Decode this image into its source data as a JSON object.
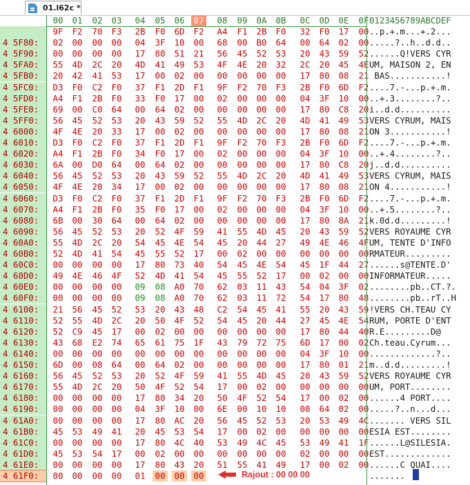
{
  "tab": {
    "title": "01.l62c *"
  },
  "header": {
    "columns": [
      "00",
      "01",
      "02",
      "03",
      "04",
      "05",
      "06",
      "07",
      "08",
      "09",
      "0A",
      "0B",
      "0C",
      "0D",
      "0E",
      "0F"
    ],
    "ascii_header": "0123456789ABCDEF",
    "highlighted_column": "07"
  },
  "annotation": {
    "text": "Rajout : 00 00 00"
  },
  "rows": [
    {
      "addr": "",
      "hex": [
        "9F",
        "F2",
        "70",
        "F3",
        "2B",
        "F0",
        "6D",
        "F2",
        "A4",
        "F1",
        "2B",
        "F0",
        "32",
        "F0",
        "17",
        "00"
      ],
      "ascii": "..p.+.m...+.2..."
    },
    {
      "addr": "4 5F80:",
      "hex": [
        "02",
        "00",
        "00",
        "00",
        "04",
        "3F",
        "10",
        "00",
        "68",
        "00",
        "B0",
        "64",
        "00",
        "64",
        "02",
        "00"
      ],
      "ascii": ".....?..h..d.d.."
    },
    {
      "addr": "4 5F90:",
      "hex": [
        "00",
        "00",
        "00",
        "00",
        "17",
        "80",
        "51",
        "21",
        "56",
        "45",
        "52",
        "53",
        "20",
        "43",
        "59",
        "52"
      ],
      "ascii": "......Q!VERS CYR"
    },
    {
      "addr": "4 5FA0:",
      "hex": [
        "55",
        "4D",
        "2C",
        "20",
        "4D",
        "41",
        "49",
        "53",
        "4F",
        "4E",
        "20",
        "32",
        "2C",
        "20",
        "45",
        "4E"
      ],
      "ascii": "UM, MAISON 2, EN"
    },
    {
      "addr": "4 5FB0:",
      "hex": [
        "20",
        "42",
        "41",
        "53",
        "17",
        "00",
        "02",
        "00",
        "00",
        "00",
        "00",
        "00",
        "17",
        "80",
        "08",
        "21"
      ],
      "ascii": " BAS...........!"
    },
    {
      "addr": "4 5FC0:",
      "hex": [
        "D3",
        "F0",
        "C2",
        "F0",
        "37",
        "F1",
        "2D",
        "F1",
        "9F",
        "F2",
        "70",
        "F3",
        "2B",
        "F0",
        "6D",
        "F2"
      ],
      "ascii": "....7.-...p.+.m."
    },
    {
      "addr": "4 5FD0:",
      "hex": [
        "A4",
        "F1",
        "2B",
        "F0",
        "33",
        "F0",
        "17",
        "00",
        "02",
        "00",
        "00",
        "00",
        "04",
        "3F",
        "10",
        "00"
      ],
      "ascii": "..+.3........?.."
    },
    {
      "addr": "4 5FE0:",
      "hex": [
        "69",
        "00",
        "C0",
        "64",
        "00",
        "64",
        "02",
        "00",
        "00",
        "00",
        "00",
        "00",
        "17",
        "80",
        "C8",
        "20"
      ],
      "ascii": "i..d.d.........."
    },
    {
      "addr": "4 5FF0:",
      "hex": [
        "56",
        "45",
        "52",
        "53",
        "20",
        "43",
        "59",
        "52",
        "55",
        "4D",
        "2C",
        "20",
        "4D",
        "41",
        "49",
        "53"
      ],
      "ascii": "VERS CYRUM, MAIS"
    },
    {
      "addr": "4 6000:",
      "hex": [
        "4F",
        "4E",
        "20",
        "33",
        "17",
        "00",
        "02",
        "00",
        "00",
        "00",
        "00",
        "00",
        "17",
        "80",
        "08",
        "21"
      ],
      "ascii": "ON 3...........!"
    },
    {
      "addr": "4 6010:",
      "hex": [
        "D3",
        "F0",
        "C2",
        "F0",
        "37",
        "F1",
        "2D",
        "F1",
        "9F",
        "F2",
        "70",
        "F3",
        "2B",
        "F0",
        "6D",
        "F2"
      ],
      "ascii": "....7.-...p.+.m."
    },
    {
      "addr": "4 6020:",
      "hex": [
        "A4",
        "F1",
        "2B",
        "F0",
        "34",
        "F0",
        "17",
        "00",
        "02",
        "00",
        "00",
        "00",
        "04",
        "3F",
        "10",
        "00"
      ],
      "ascii": "..+.4........?.."
    },
    {
      "addr": "4 6030:",
      "hex": [
        "6A",
        "00",
        "D0",
        "64",
        "00",
        "64",
        "02",
        "00",
        "00",
        "00",
        "00",
        "00",
        "17",
        "80",
        "C8",
        "20"
      ],
      "ascii": "j..d.d.........."
    },
    {
      "addr": "4 6040:",
      "hex": [
        "56",
        "45",
        "52",
        "53",
        "20",
        "43",
        "59",
        "52",
        "55",
        "4D",
        "2C",
        "20",
        "4D",
        "41",
        "49",
        "53"
      ],
      "ascii": "VERS CYRUM, MAIS"
    },
    {
      "addr": "4 6050:",
      "hex": [
        "4F",
        "4E",
        "20",
        "34",
        "17",
        "00",
        "02",
        "00",
        "00",
        "00",
        "00",
        "00",
        "17",
        "80",
        "08",
        "21"
      ],
      "ascii": "ON 4...........!"
    },
    {
      "addr": "4 6060:",
      "hex": [
        "D3",
        "F0",
        "C2",
        "F0",
        "37",
        "F1",
        "2D",
        "F1",
        "9F",
        "F2",
        "70",
        "F3",
        "2B",
        "F0",
        "6D",
        "F2"
      ],
      "ascii": "....7.-...p.+.m."
    },
    {
      "addr": "4 6070:",
      "hex": [
        "A4",
        "F1",
        "2B",
        "F0",
        "35",
        "F0",
        "17",
        "00",
        "02",
        "00",
        "00",
        "00",
        "04",
        "3F",
        "10",
        "00"
      ],
      "ascii": "..+.5........?.."
    },
    {
      "addr": "4 6080:",
      "hex": [
        "6B",
        "00",
        "30",
        "64",
        "00",
        "64",
        "02",
        "00",
        "00",
        "00",
        "00",
        "00",
        "17",
        "80",
        "8A",
        "21"
      ],
      "ascii": "k.0d.d.........!"
    },
    {
      "addr": "4 6090:",
      "hex": [
        "56",
        "45",
        "52",
        "53",
        "20",
        "52",
        "4F",
        "59",
        "41",
        "55",
        "4D",
        "45",
        "20",
        "43",
        "59",
        "52"
      ],
      "ascii": "VERS ROYAUME CYR"
    },
    {
      "addr": "4 60A0:",
      "hex": [
        "55",
        "4D",
        "2C",
        "20",
        "54",
        "45",
        "4E",
        "54",
        "45",
        "20",
        "44",
        "27",
        "49",
        "4E",
        "46",
        "4F"
      ],
      "ascii": "UM, TENTE D'INFO"
    },
    {
      "addr": "4 60B0:",
      "hex": [
        "52",
        "4D",
        "41",
        "54",
        "45",
        "55",
        "52",
        "17",
        "00",
        "02",
        "00",
        "00",
        "00",
        "00",
        "00",
        "00"
      ],
      "ascii": "RMATEUR........."
    },
    {
      "addr": "4 60C0:",
      "hex": [
        "00",
        "00",
        "00",
        "00",
        "17",
        "80",
        "73",
        "40",
        "54",
        "45",
        "4E",
        "54",
        "45",
        "1F",
        "44",
        "27"
      ],
      "ascii": "......s@TENTE.D'"
    },
    {
      "addr": "4 60D0:",
      "hex": [
        "49",
        "4E",
        "46",
        "4F",
        "52",
        "4D",
        "41",
        "54",
        "45",
        "55",
        "52",
        "17",
        "00",
        "02",
        "00",
        "00"
      ],
      "ascii": "INFORMATEUR....."
    },
    {
      "addr": "4 60E0:",
      "hex": [
        "00",
        "00",
        "00",
        "00",
        "09",
        "08",
        "A0",
        "70",
        "62",
        "03",
        "11",
        "43",
        "54",
        "04",
        "3F",
        "02"
      ],
      "ascii": "........pb..CT.?."
    },
    {
      "addr": "4 60F0:",
      "hex": [
        "00",
        "00",
        "00",
        "00",
        "09",
        "08",
        "A0",
        "70",
        "62",
        "03",
        "11",
        "72",
        "54",
        "17",
        "80",
        "48"
      ],
      "ascii": "........pb..rT..H"
    },
    {
      "addr": "4 6100:",
      "hex": [
        "21",
        "56",
        "45",
        "52",
        "53",
        "20",
        "43",
        "48",
        "C2",
        "54",
        "45",
        "41",
        "55",
        "20",
        "43",
        "59"
      ],
      "ascii": "!VERS CH.TEAU CY"
    },
    {
      "addr": "4 6110:",
      "hex": [
        "52",
        "55",
        "4D",
        "2C",
        "20",
        "50",
        "4F",
        "52",
        "54",
        "45",
        "20",
        "44",
        "27",
        "45",
        "4E",
        "54"
      ],
      "ascii": "RUM, PORTE D'ENT"
    },
    {
      "addr": "4 6120:",
      "hex": [
        "52",
        "C9",
        "45",
        "17",
        "00",
        "02",
        "00",
        "00",
        "00",
        "00",
        "00",
        "00",
        "17",
        "80",
        "44",
        "40"
      ],
      "ascii": "R.E.........D@"
    },
    {
      "addr": "4 6130:",
      "hex": [
        "43",
        "68",
        "E2",
        "74",
        "65",
        "61",
        "75",
        "1F",
        "43",
        "79",
        "72",
        "75",
        "6D",
        "17",
        "00",
        "02"
      ],
      "ascii": "Ch.teau.Cyrum..."
    },
    {
      "addr": "4 6140:",
      "hex": [
        "00",
        "00",
        "00",
        "00",
        "00",
        "00",
        "00",
        "00",
        "00",
        "00",
        "00",
        "00",
        "04",
        "3F",
        "10",
        "00"
      ],
      "ascii": ".............?.."
    },
    {
      "addr": "4 6150:",
      "hex": [
        "6D",
        "00",
        "08",
        "64",
        "00",
        "64",
        "02",
        "00",
        "00",
        "00",
        "00",
        "00",
        "17",
        "80",
        "01",
        "21"
      ],
      "ascii": "m..d.d.........!"
    },
    {
      "addr": "4 6160:",
      "hex": [
        "56",
        "45",
        "52",
        "53",
        "20",
        "52",
        "4F",
        "59",
        "41",
        "55",
        "4D",
        "45",
        "20",
        "43",
        "59",
        "52"
      ],
      "ascii": "VERS ROYAUME CYR"
    },
    {
      "addr": "4 6170:",
      "hex": [
        "55",
        "4D",
        "2C",
        "20",
        "50",
        "4F",
        "52",
        "54",
        "17",
        "00",
        "02",
        "00",
        "00",
        "00",
        "00",
        "00"
      ],
      "ascii": "UM, PORT........"
    },
    {
      "addr": "4 6180:",
      "hex": [
        "00",
        "00",
        "00",
        "00",
        "17",
        "80",
        "34",
        "20",
        "50",
        "4F",
        "52",
        "54",
        "17",
        "00",
        "02",
        "00"
      ],
      "ascii": "......4 PORT...."
    },
    {
      "addr": "4 6190:",
      "hex": [
        "00",
        "00",
        "00",
        "00",
        "04",
        "3F",
        "10",
        "00",
        "6E",
        "00",
        "10",
        "10",
        "00",
        "64",
        "02",
        "00"
      ],
      "ascii": ".....?..n...d..."
    },
    {
      "addr": "4 61A0:",
      "hex": [
        "00",
        "00",
        "00",
        "00",
        "17",
        "80",
        "AC",
        "20",
        "56",
        "45",
        "52",
        "53",
        "20",
        "53",
        "49",
        "4C"
      ],
      "ascii": "....... VERS SIL"
    },
    {
      "addr": "4 61B0:",
      "hex": [
        "45",
        "53",
        "49",
        "41",
        "20",
        "45",
        "53",
        "54",
        "17",
        "00",
        "02",
        "00",
        "00",
        "00",
        "00",
        "00"
      ],
      "ascii": "ESIA EST........"
    },
    {
      "addr": "4 61C0:",
      "hex": [
        "00",
        "00",
        "00",
        "00",
        "17",
        "80",
        "4C",
        "40",
        "53",
        "49",
        "4C",
        "45",
        "53",
        "49",
        "41",
        "1F"
      ],
      "ascii": "......L@SILESIA."
    },
    {
      "addr": "4 61D0:",
      "hex": [
        "45",
        "53",
        "54",
        "17",
        "00",
        "02",
        "00",
        "00",
        "00",
        "00",
        "00",
        "00",
        "02",
        "00",
        "00",
        "00"
      ],
      "ascii": "EST............."
    },
    {
      "addr": "4 61E0:",
      "hex": [
        "00",
        "00",
        "00",
        "00",
        "17",
        "80",
        "43",
        "20",
        "51",
        "55",
        "41",
        "49",
        "17",
        "00",
        "02",
        "00"
      ],
      "ascii": "......C QUAI...."
    },
    {
      "addr": "4 61F0:",
      "hex": [
        "00",
        "00",
        "00",
        "00",
        "01",
        "00",
        "00",
        "00",
        "",
        "",
        "",
        "",
        "",
        "",
        "",
        ""
      ],
      "ascii": "......."
    }
  ],
  "colors": {
    "addr_bg": "#c6ecc6",
    "hex_text": "#cc0000",
    "header_text": "#2a7a2a",
    "highlight": "#ffcfaa",
    "annotation": "#e03030"
  }
}
